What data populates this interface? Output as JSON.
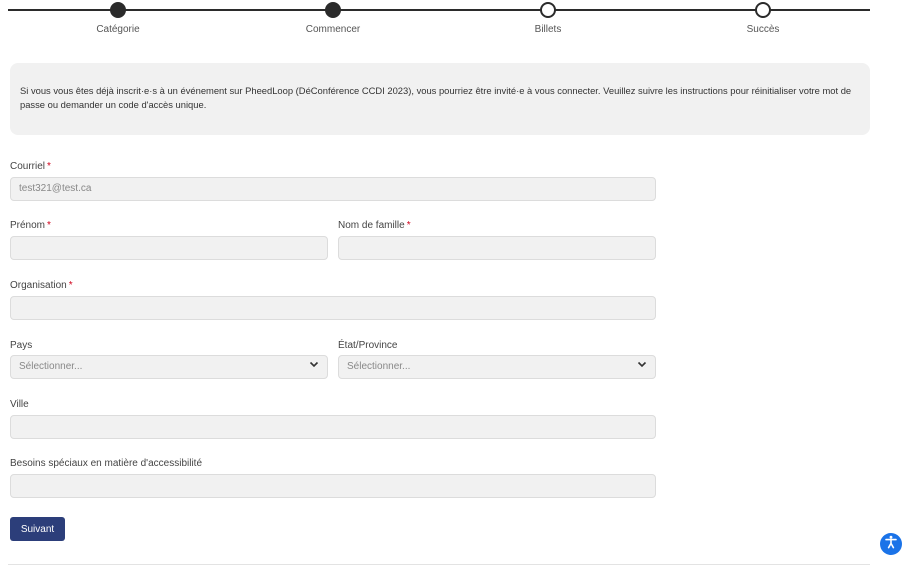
{
  "steps": [
    {
      "label": "Catégorie",
      "status": "completed"
    },
    {
      "label": "Commencer",
      "status": "current"
    },
    {
      "label": "Billets",
      "status": "upcoming"
    },
    {
      "label": "Succès",
      "status": "upcoming"
    }
  ],
  "info_text": "Si vous vous êtes déjà inscrit·e·s à un événement sur PheedLoop (DéConférence CCDI 2023), vous pourriez être invité·e à vous connecter. Veuillez suivre les instructions pour réinitialiser votre mot de passe ou demander un code d'accès unique.",
  "form": {
    "email": {
      "label": "Courriel",
      "required": "*",
      "value": "test321@test.ca"
    },
    "first_name": {
      "label": "Prénom",
      "required": "*",
      "value": ""
    },
    "last_name": {
      "label": "Nom de famille",
      "required": "*",
      "value": ""
    },
    "organization": {
      "label": "Organisation",
      "required": "*",
      "value": ""
    },
    "country": {
      "label": "Pays",
      "selected": "Sélectionner..."
    },
    "province": {
      "label": "État/Province",
      "selected": "Sélectionner..."
    },
    "city": {
      "label": "Ville",
      "value": ""
    },
    "accessibility": {
      "label": "Besoins spéciaux en matière d'accessibilité",
      "value": ""
    },
    "submit_label": "Suivant"
  },
  "icons": {
    "accessibility_widget": "accessibility-icon",
    "select_arrow": "chevron-down-icon"
  },
  "colors": {
    "primary_button": "#2c3e7a",
    "required_asterisk": "#d0021b",
    "accessibility_widget": "#1a73e8"
  }
}
